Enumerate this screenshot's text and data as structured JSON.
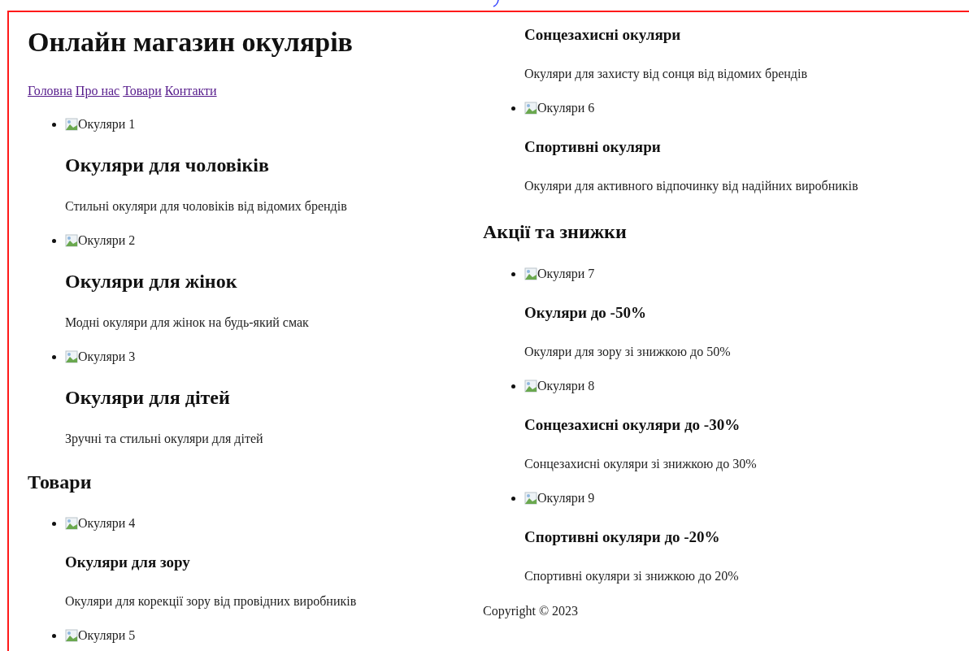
{
  "title": "Онлайн магазин окулярів",
  "nav": [
    "Головна",
    "Про нас",
    "Товари",
    "Контакти"
  ],
  "featured": [
    {
      "image_alt": "Окуляри 1",
      "title": "Окуляри для чоловіків",
      "description": "Стильні окуляри для чоловіків від відомих брендів"
    },
    {
      "image_alt": "Окуляри 2",
      "title": "Окуляри для жінок",
      "description": "Модні окуляри для жінок на будь-який смак"
    },
    {
      "image_alt": "Окуляри 3",
      "title": "Окуляри для дітей",
      "description": "Зручні та стильні окуляри для дітей"
    }
  ],
  "sections": [
    {
      "heading": "Товари",
      "products": [
        {
          "image_alt": "Окуляри 4",
          "title": "Окуляри для зору",
          "description": "Окуляри для корекції зору від провідних виробників"
        },
        {
          "image_alt": "Окуляри 5",
          "title": "Сонцезахисні окуляри",
          "description": "Окуляри для захисту від сонця від відомих брендів"
        },
        {
          "image_alt": "Окуляри 6",
          "title": "Спортивні окуляри",
          "description": "Окуляри для активного відпочинку від надійних виробників"
        }
      ]
    },
    {
      "heading": "Акції та знижки",
      "products": [
        {
          "image_alt": "Окуляри 7",
          "title": "Окуляри до -50%",
          "description": "Окуляри для зору зі знижкою до 50%"
        },
        {
          "image_alt": "Окуляри 8",
          "title": "Сонцезахисні окуляри до -30%",
          "description": "Сонцезахисні окуляри зі знижкою до 30%"
        },
        {
          "image_alt": "Окуляри 9",
          "title": "Спортивні окуляри до -20%",
          "description": "Спортивні окуляри зі знижкою до 20%"
        }
      ]
    }
  ],
  "footer": "Copyright © 2023"
}
